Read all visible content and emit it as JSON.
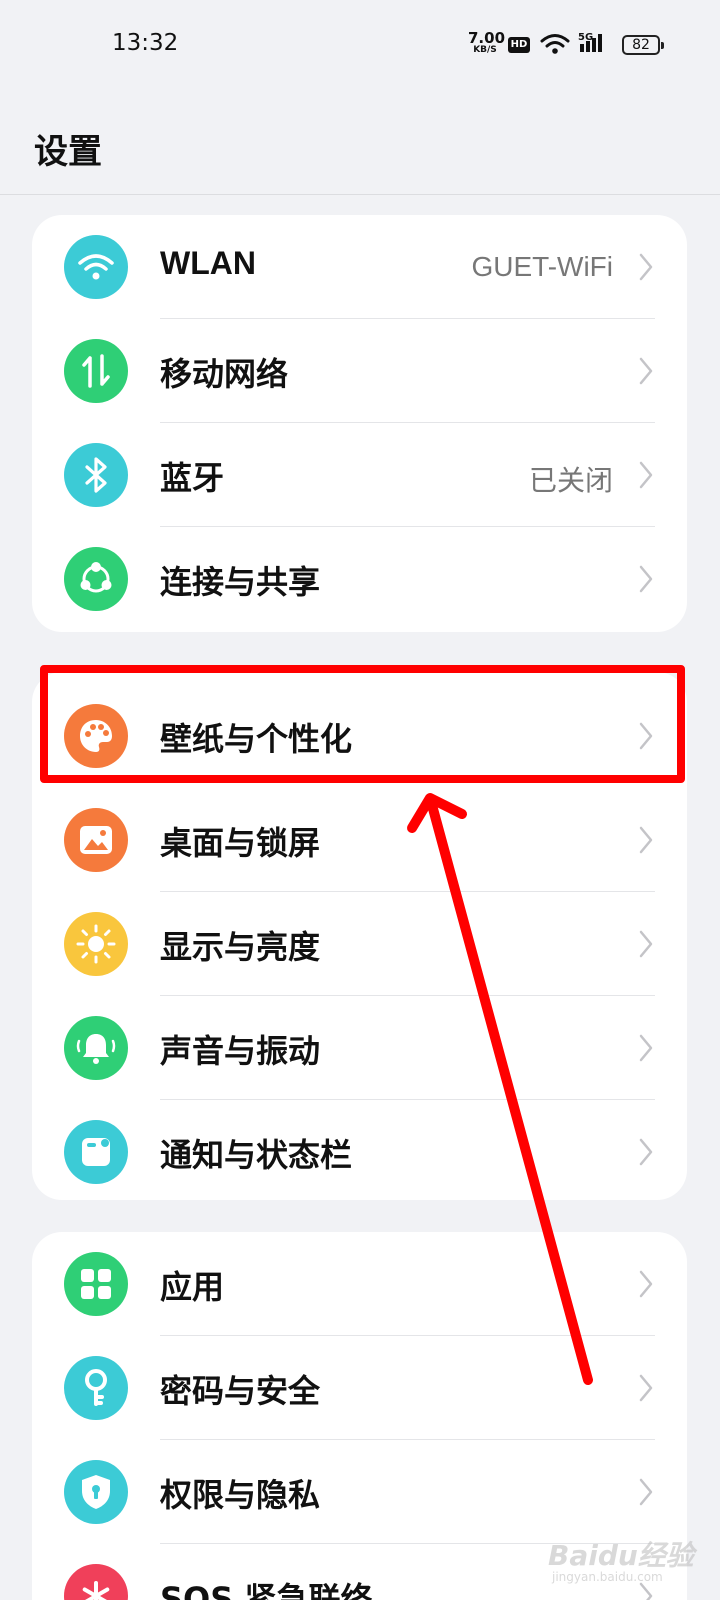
{
  "status_bar": {
    "time": "13:32",
    "net_speed": "7.00",
    "net_unit": "KB/S",
    "hd": "HD",
    "signal_type": "5G",
    "battery": "82"
  },
  "page": {
    "title": "设置"
  },
  "groups": [
    {
      "items": [
        {
          "label": "WLAN",
          "value": "GUET-WiFi",
          "icon": "wifi-icon",
          "color": "#3ccbd6"
        },
        {
          "label": "移动网络",
          "value": "",
          "icon": "mobile-data-icon",
          "color": "#2fcf76"
        },
        {
          "label": "蓝牙",
          "value": "已关闭",
          "icon": "bluetooth-icon",
          "color": "#3ccbd6"
        },
        {
          "label": "连接与共享",
          "value": "",
          "icon": "share-icon",
          "color": "#2fcf76"
        }
      ]
    },
    {
      "items": [
        {
          "label": "壁纸与个性化",
          "value": "",
          "icon": "palette-icon",
          "color": "#f57a3c"
        },
        {
          "label": "桌面与锁屏",
          "value": "",
          "icon": "picture-icon",
          "color": "#f57a3c"
        },
        {
          "label": "显示与亮度",
          "value": "",
          "icon": "sun-icon",
          "color": "#f9c63d"
        },
        {
          "label": "声音与振动",
          "value": "",
          "icon": "bell-icon",
          "color": "#2fcf76"
        },
        {
          "label": "通知与状态栏",
          "value": "",
          "icon": "notification-icon",
          "color": "#3ccbd6"
        }
      ]
    },
    {
      "items": [
        {
          "label": "应用",
          "value": "",
          "icon": "apps-grid-icon",
          "color": "#2fcf76"
        },
        {
          "label": "密码与安全",
          "value": "",
          "icon": "key-icon",
          "color": "#3ccbd6"
        },
        {
          "label": "权限与隐私",
          "value": "",
          "icon": "shield-lock-icon",
          "color": "#3ccbd6"
        },
        {
          "label": "SOS 紧急联络",
          "value": "",
          "icon": "sos-icon",
          "color": "#f0405a"
        }
      ]
    }
  ],
  "watermark": {
    "text": "Baidu经验",
    "sub": "jingyan.baidu.com"
  }
}
